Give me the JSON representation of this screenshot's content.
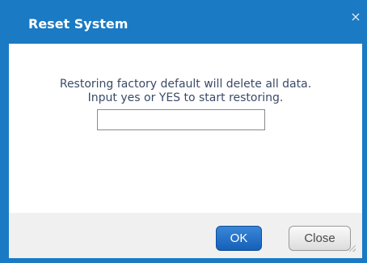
{
  "dialog": {
    "title": "Reset System",
    "close_icon": "×",
    "message_line1": "Restoring factory default will delete all data.",
    "message_line2": "Input yes or YES to start restoring.",
    "input_value": "",
    "ok_label": "OK",
    "close_label": "Close"
  },
  "colors": {
    "titlebar": "#1a7ac4",
    "ok_button": "#1560b8",
    "message_text": "#3a4a68",
    "footer": "#f0f0f0"
  },
  "icons": {
    "close": "close-icon",
    "resize": "resize-grip-icon"
  }
}
